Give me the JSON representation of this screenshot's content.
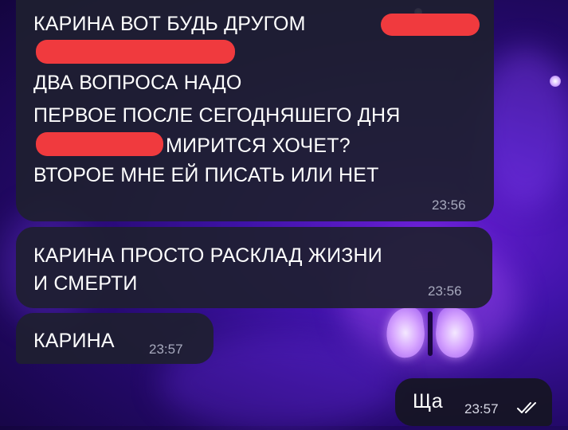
{
  "messages": [
    {
      "direction": "incoming",
      "lines": [
        "КАРИНА ВОТ БУДЬ ДРУГОМ",
        "",
        "ДВА ВОПРОСА НАДО",
        "ПЕРВОЕ ПОСЛЕ СЕГОДНЯШЕГО ДНЯ",
        "МИРИТСЯ ХОЧЕТ?",
        "ВТОРОЕ МНЕ ЕЙ ПИСАТЬ ИЛИ НЕТ"
      ],
      "time": "23:56"
    },
    {
      "direction": "incoming",
      "lines": [
        "КАРИНА ПРОСТО РАСКЛАД ЖИЗНИ",
        "И СМЕРТИ"
      ],
      "time": "23:56"
    },
    {
      "direction": "incoming",
      "lines": [
        "КАРИНА"
      ],
      "time": "23:57"
    },
    {
      "direction": "outgoing",
      "text": "Ща",
      "time": "23:57",
      "status_icon": "double-check-icon"
    }
  ],
  "colors": {
    "redaction": "#f03a3e",
    "bubble_incoming": "#1e2030",
    "bubble_outgoing": "#161622",
    "timestamp": "#a7a9bd",
    "background_accent": "#4b14b8"
  }
}
